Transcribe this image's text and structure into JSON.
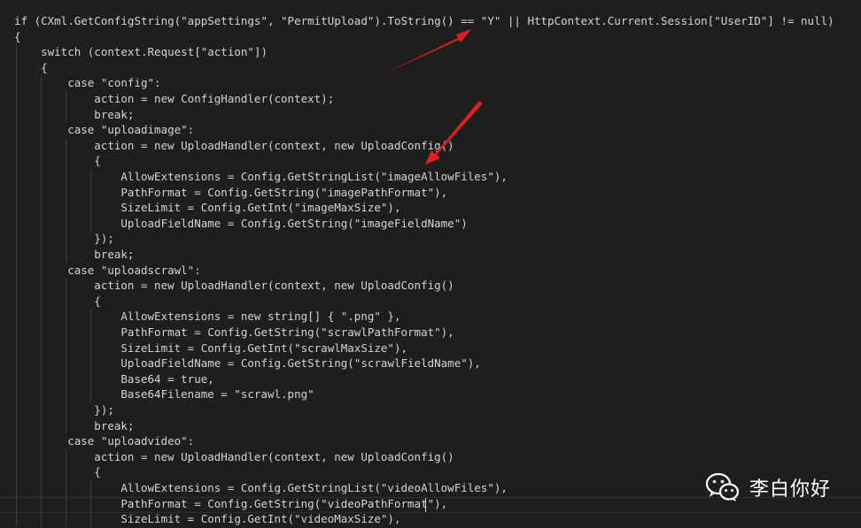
{
  "editor": {
    "lines": [
      "if (CXml.GetConfigString(\"appSettings\", \"PermitUpload\").ToString() == \"Y\" || HttpContext.Current.Session[\"UserID\"] != null)",
      "{",
      "    switch (context.Request[\"action\"])",
      "    {",
      "        case \"config\":",
      "            action = new ConfigHandler(context);",
      "            break;",
      "        case \"uploadimage\":",
      "            action = new UploadHandler(context, new UploadConfig()",
      "            {",
      "                AllowExtensions = Config.GetStringList(\"imageAllowFiles\"),",
      "                PathFormat = Config.GetString(\"imagePathFormat\"),",
      "                SizeLimit = Config.GetInt(\"imageMaxSize\"),",
      "                UploadFieldName = Config.GetString(\"imageFieldName\")",
      "            });",
      "            break;",
      "        case \"uploadscrawl\":",
      "            action = new UploadHandler(context, new UploadConfig()",
      "            {",
      "                AllowExtensions = new string[] { \".png\" },",
      "                PathFormat = Config.GetString(\"scrawlPathFormat\"),",
      "                SizeLimit = Config.GetInt(\"scrawlMaxSize\"),",
      "                UploadFieldName = Config.GetString(\"scrawlFieldName\"),",
      "                Base64 = true,",
      "                Base64Filename = \"scrawl.png\"",
      "            });",
      "            break;",
      "        case \"uploadvideo\":",
      "            action = new UploadHandler(context, new UploadConfig()",
      "            {",
      "                AllowExtensions = Config.GetStringList(\"videoAllowFiles\"),",
      "                PathFormat = Config.GetString(\"videoPathFormat\"),",
      "                SizeLimit = Config.GetInt(\"videoMaxSize\"),"
    ]
  },
  "annotations": {
    "arrow_color": "#e02020"
  },
  "watermark": {
    "icon": "wechat-icon",
    "text": "李白你好"
  },
  "colors": {
    "background": "#1e1e1e",
    "text": "#d4d4d4",
    "indent_guide": "#404040",
    "annotation": "#e02020"
  }
}
